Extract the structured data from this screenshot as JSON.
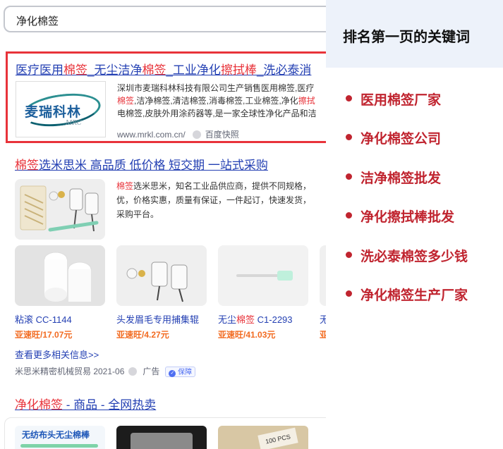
{
  "search": {
    "query": "净化棉签"
  },
  "result1": {
    "title_parts": [
      {
        "t": "医疗医用",
        "hl": false
      },
      {
        "t": "棉签",
        "hl": true
      },
      {
        "t": "_无尘洁净",
        "hl": false
      },
      {
        "t": "棉签",
        "hl": true
      },
      {
        "t": "_工业净化",
        "hl": false
      },
      {
        "t": "擦拭棒",
        "hl": true
      },
      {
        "t": "_洗必泰消",
        "hl": false
      }
    ],
    "logo_cn": "麦瑞科林",
    "logo_en": "MRC",
    "desc_line1": "深圳市麦瑞科林科技有限公司生产销售医用棉签,医疗",
    "desc_line2_hl": "棉签",
    "desc_line2": ",洁净棉签,清洁棉签,消毒棉签,工业棉签,净化",
    "desc_line2_tail": "擦拭",
    "desc_line3": "电棉签,皮肤外用涂药器等,是一家全球性净化产品和洁",
    "url": "www.mrkl.com.cn/",
    "snapshot": "百度快照"
  },
  "result2": {
    "title_hl": "棉签",
    "title": "选米思米 高品质 低价格 短交期 一站式采购",
    "desc_hl": "棉签",
    "desc_line1": "选米思米，知名工业品供应商，提供不同规格，",
    "desc_line2": "优，价格实惠，质量有保证，一件起订，快速发货，",
    "desc_line3": "采购平台。",
    "products": [
      {
        "name": "粘滚 CC-1144",
        "name_hl": "",
        "price": "亚速旺/17.07元"
      },
      {
        "name": "头发眉毛专用捕集辊",
        "name_hl": "",
        "price": "亚速旺/4.27元"
      },
      {
        "name_pre": "无尘",
        "name_hl": "棉签",
        "name": " C1-2293",
        "price": "亚速旺/41.03元"
      },
      {
        "name": "无",
        "name_hl": "",
        "price": "亚"
      }
    ],
    "more_link": "查看更多相关信息>>",
    "source": "米思米精密机械贸易 2021-06",
    "ad_label": "广告",
    "badge": "保障"
  },
  "result3": {
    "title_hl": "净化棉签",
    "title": " - 商品 - 全网热卖",
    "tile1_label": "无纺布头无尘棉棒",
    "tile3_label": "100 PCS"
  },
  "panel": {
    "title": "排名第一页的关键词",
    "keywords": [
      "医用棉签厂家",
      "净化棉签公司",
      "洁净棉签批发",
      "净化擦拭棒批发",
      "洗必泰棉签多少钱",
      "净化棉签生产厂家"
    ]
  }
}
